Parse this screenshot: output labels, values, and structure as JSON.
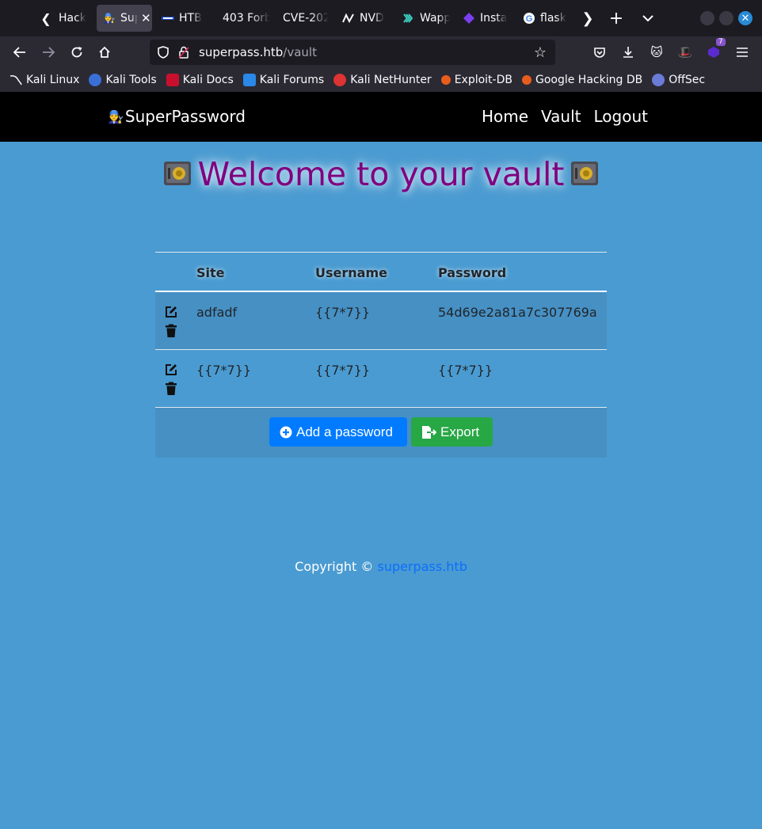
{
  "browser": {
    "tabs": [
      {
        "title": "Hack",
        "icon": "hackthebox-icon"
      },
      {
        "title": "Sup",
        "icon": "superpass-icon",
        "active": true
      },
      {
        "title": "HTB",
        "icon": "htb-icon"
      },
      {
        "title": "403 Forb",
        "icon": ""
      },
      {
        "title": "CVE-202",
        "icon": ""
      },
      {
        "title": "NVD",
        "icon": "nvd-icon"
      },
      {
        "title": "Wapp",
        "icon": "wappalyzer-icon"
      },
      {
        "title": "Insta",
        "icon": "instagram-icon"
      },
      {
        "title": "flask",
        "icon": "google-icon"
      }
    ],
    "url_host": "superpass.htb",
    "url_path": "/vault",
    "extension_badge": "7",
    "bookmarks": [
      {
        "label": "Kali Linux",
        "icon": "kali-icon",
        "color": "#1c1b22"
      },
      {
        "label": "Kali Tools",
        "icon": "kali-tools-icon",
        "color": "#3a6fd8"
      },
      {
        "label": "Kali Docs",
        "icon": "kali-docs-icon",
        "color": "#d22"
      },
      {
        "label": "Kali Forums",
        "icon": "kali-forums-icon",
        "color": "#2a88e8"
      },
      {
        "label": "Kali NetHunter",
        "icon": "nethunter-icon",
        "color": "#d33"
      },
      {
        "label": "Exploit-DB",
        "icon": "exploitdb-icon",
        "color": "#e85d1e"
      },
      {
        "label": "Google Hacking DB",
        "icon": "ghdb-icon",
        "color": "#e85d1e"
      },
      {
        "label": "OffSec",
        "icon": "offsec-icon",
        "color": "#6b7bd8"
      }
    ]
  },
  "site": {
    "brand": "SuperPassword",
    "nav": [
      "Home",
      "Vault",
      "Logout"
    ],
    "welcome": "Welcome to your vault",
    "table": {
      "headers": {
        "site": "Site",
        "username": "Username",
        "password": "Password"
      },
      "rows": [
        {
          "site": "adfadf",
          "username": "{{7*7}}",
          "password": "54d69e2a81a7c307769a"
        },
        {
          "site": "{{7*7}}",
          "username": "{{7*7}}",
          "password": "{{7*7}}"
        }
      ]
    },
    "buttons": {
      "add": "Add a password",
      "export": "Export"
    },
    "footer": {
      "text": "Copyright © ",
      "link": "superpass.htb"
    }
  },
  "colors": {
    "page_bg": "#4a9bd1",
    "welcome": "#800080",
    "add_button": "#007bff",
    "export_button": "#28a745",
    "footer_link": "#0d6efd"
  }
}
